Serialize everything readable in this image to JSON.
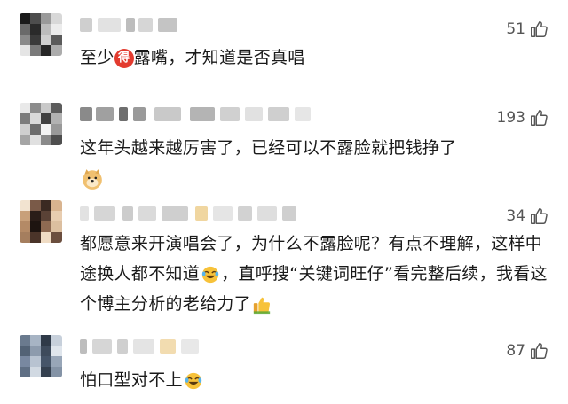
{
  "comments": [
    {
      "likes": "51",
      "text_before": "至少",
      "badge": "得",
      "text_after": "露嘴，才知道是否真唱",
      "avatar_colors": [
        "#1a1a1a",
        "#4d4d4d",
        "#9a9a9a",
        "#d8d8d8",
        "#6a6a6a",
        "#2a2a2a",
        "#bcbcbc",
        "#ececec",
        "#8a8a8a",
        "#3a3a3a",
        "#cfcfcf",
        "#5a5a5a",
        "#e5e5e5",
        "#7a7a7a",
        "#262626",
        "#acacac"
      ],
      "emoji_after": ""
    },
    {
      "likes": "193",
      "text_before": "这年头越来越厉害了，已经可以不露脸就把钱挣了",
      "emoji_end": "doge-emoji",
      "avatar_colors": [
        "#e9e9e9",
        "#8c8c8c",
        "#c9c9c9",
        "#5c5c5c",
        "#7c7c7c",
        "#dadada",
        "#404040",
        "#b2b2b2",
        "#cfcfcf",
        "#6d6d6d",
        "#f2f2f2",
        "#999999",
        "#a5a5a5",
        "#e0e0e0",
        "#8a8a8a",
        "#4e4e4e"
      ]
    },
    {
      "likes": "34",
      "text_part1": "都愿意来开演唱会了，为什么不露脸呢？有点不理解，这样中途换人都不知道",
      "emoji_mid": "laugh-cry-emoji",
      "text_part2": "，直呼搜“关键词旺仔”看完整后续，我看这个博主分析的老给力了",
      "emoji_end": "thumbs-up-emoji",
      "avatar_colors": [
        "#f2e3d0",
        "#7a5a48",
        "#3b2a22",
        "#d9b48f",
        "#c8a07a",
        "#2a1d18",
        "#5a4236",
        "#e8cdb0",
        "#b48a66",
        "#1d1410",
        "#8e6a52",
        "#dcbfa0",
        "#a57e5e",
        "#4a3429",
        "#f0dcc4",
        "#6b4e3e"
      ]
    },
    {
      "likes": "87",
      "text_before": "怕口型对不上",
      "emoji_end": "laugh-cry-emoji",
      "avatar_colors": [
        "#6a7a8e",
        "#a7b4c4",
        "#2f3a48",
        "#c7d0db",
        "#526275",
        "#8d9bad",
        "#3e4b5c",
        "#dfe5ec",
        "#7888a0",
        "#b8c3d1",
        "#465569",
        "#98a6b8",
        "#5f6f84",
        "#d1d9e2",
        "#34404f",
        "#8493a6"
      ]
    }
  ],
  "colors": {
    "badge": "#e33b2f",
    "text": "#1a1a1a",
    "likes": "#555555"
  }
}
